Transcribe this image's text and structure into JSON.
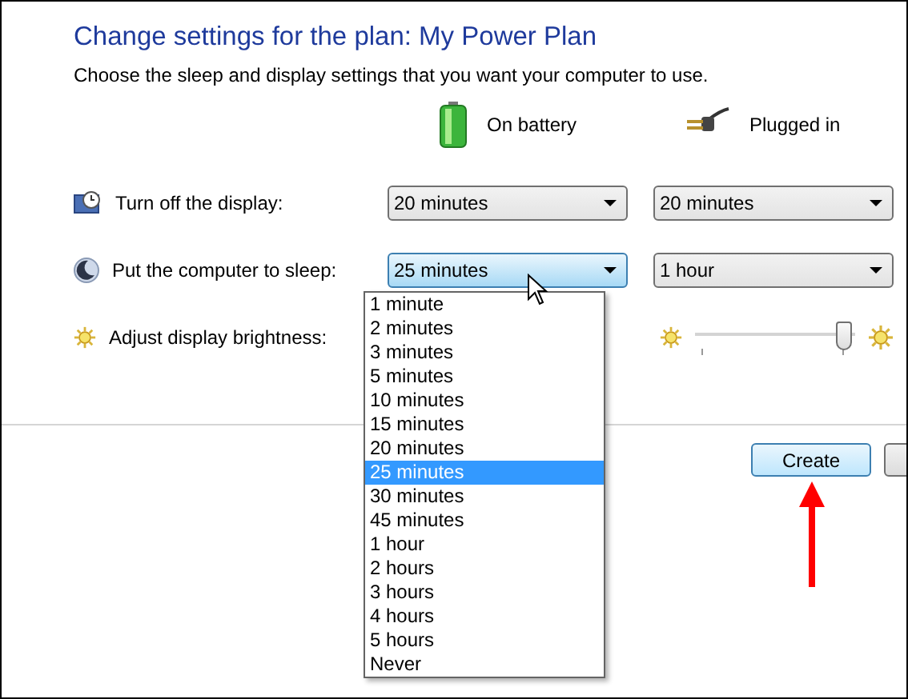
{
  "title": "Change settings for the plan: My Power Plan",
  "subtitle": "Choose the sleep and display settings that you want your computer to use.",
  "columns": [
    {
      "label": "On battery",
      "kind": "battery"
    },
    {
      "label": "Plugged in",
      "kind": "plug"
    }
  ],
  "settings": [
    {
      "label": "Turn off the display:",
      "kind": "display",
      "battery": {
        "value": "20 minutes",
        "focused": false
      },
      "plugged_in": {
        "value": "20 minutes",
        "focused": false
      }
    },
    {
      "label": "Put the computer to sleep:",
      "kind": "sleep",
      "battery": {
        "value": "25 minutes",
        "focused": true
      },
      "plugged_in": {
        "value": "1 hour",
        "focused": false
      }
    },
    {
      "label": "Adjust display brightness:",
      "kind": "brightness",
      "plugged_in": {
        "level": 0.93
      }
    }
  ],
  "dropdown": {
    "options": [
      {
        "label": "1 minute",
        "selected": false
      },
      {
        "label": "2 minutes",
        "selected": false
      },
      {
        "label": "3 minutes",
        "selected": false
      },
      {
        "label": "5 minutes",
        "selected": false
      },
      {
        "label": "10 minutes",
        "selected": false
      },
      {
        "label": "15 minutes",
        "selected": false
      },
      {
        "label": "20 minutes",
        "selected": false
      },
      {
        "label": "25 minutes",
        "selected": true
      },
      {
        "label": "30 minutes",
        "selected": false
      },
      {
        "label": "45 minutes",
        "selected": false
      },
      {
        "label": "1 hour",
        "selected": false
      },
      {
        "label": "2 hours",
        "selected": false
      },
      {
        "label": "3 hours",
        "selected": false
      },
      {
        "label": "4 hours",
        "selected": false
      },
      {
        "label": "5 hours",
        "selected": false
      },
      {
        "label": "Never",
        "selected": false
      }
    ]
  },
  "buttons": [
    {
      "label": "Create",
      "focused": true
    },
    {
      "focused": false
    }
  ],
  "annotations": [
    {
      "kind": "arrow"
    }
  ]
}
